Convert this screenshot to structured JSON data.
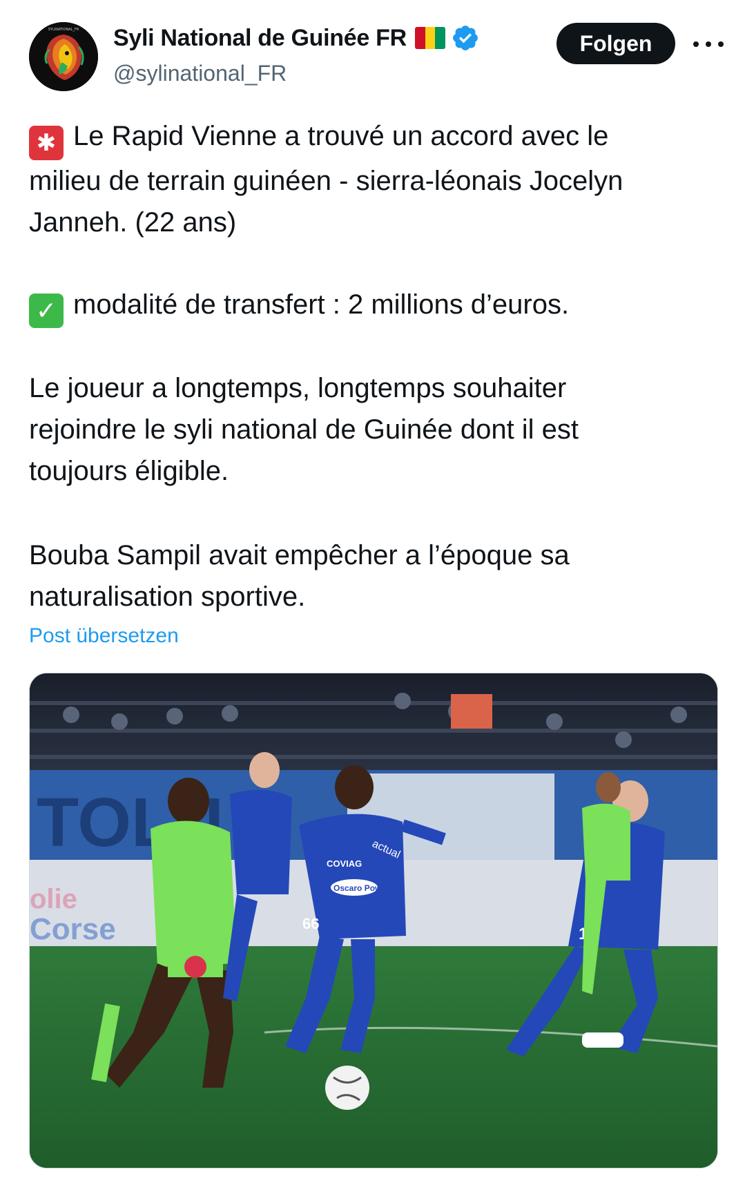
{
  "post": {
    "author": {
      "display_name": "Syli National de Guinée FR",
      "handle": "@sylinational_FR",
      "flag_colors": [
        "#ce1126",
        "#fcd116",
        "#009460"
      ],
      "verified": true,
      "verified_color": "#1d9bf0",
      "avatar_icon": "lion-logo-icon",
      "avatar_badge_text": "SYLINATIONAL_FR"
    },
    "follow_label": "Folgen",
    "more_icon": "more-icon",
    "paragraphs": {
      "p1": {
        "emoji": "siren-emoji",
        "lines": [
          "Le Rapid Vienne a trouvé un accord avec le",
          "milieu de terrain guinéen - sierra-léonais Jocelyn",
          "Janneh. (22 ans)"
        ]
      },
      "p2": {
        "emoji": "check-emoji",
        "text": "modalité de transfert : 2 millions d’euros."
      },
      "p3": {
        "lines": [
          "Le joueur a longtemps, longtemps souhaiter",
          "rejoindre le syli national de Guinée dont il est",
          "toujours éligible."
        ]
      },
      "p4": {
        "lines": [
          "Bouba Sampil avait empêcher a l’époque sa",
          "naturalisation sportive."
        ]
      }
    },
    "translate_label": "Post übersetzen",
    "translate_color": "#1d9bf0",
    "media": {
      "kind": "photo",
      "description_icon": "football-match-photo",
      "jersey_texts": [
        "COVIAG",
        "Oscaro Power",
        "actual",
        "66",
        "17"
      ],
      "banner_texts": [
        "olie",
        "Corse",
        "TOLU"
      ]
    }
  }
}
